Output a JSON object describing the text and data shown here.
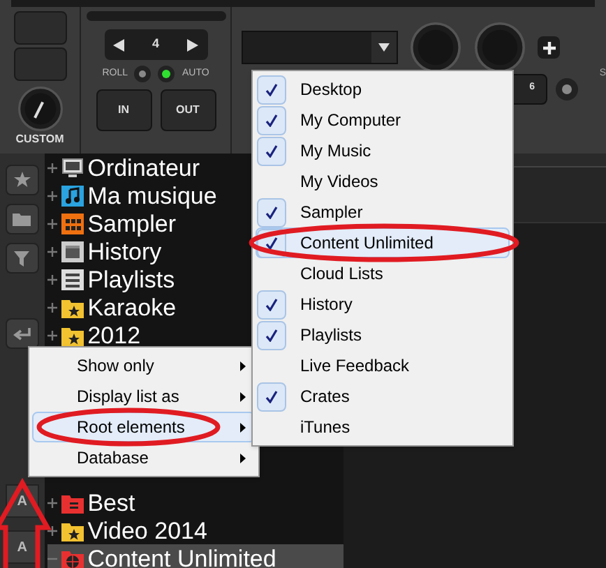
{
  "deck": {
    "loop_value": "4",
    "roll_label": "ROLL",
    "auto_label": "AUTO",
    "auto_on": true,
    "in_label": "IN",
    "out_label": "OUT",
    "knob_label": "CUSTOM",
    "pad_value": "6",
    "edge_label": "S"
  },
  "side_labels": [
    "A",
    "A"
  ],
  "tree": [
    {
      "label": "Ordinateur",
      "kind": "computer",
      "expanded": false,
      "selected": false
    },
    {
      "label": "Ma musique",
      "kind": "music",
      "expanded": false,
      "selected": false
    },
    {
      "label": "Sampler",
      "kind": "sampler",
      "expanded": false,
      "selected": false
    },
    {
      "label": "History",
      "kind": "history",
      "expanded": false,
      "selected": false
    },
    {
      "label": "Playlists",
      "kind": "playlists",
      "expanded": false,
      "selected": false
    },
    {
      "label": "Karaoke",
      "kind": "star-folder",
      "expanded": false,
      "selected": false
    },
    {
      "label": "2012",
      "kind": "star-folder",
      "expanded": false,
      "selected": false
    },
    {
      "kind": "hidden"
    },
    {
      "kind": "hidden"
    },
    {
      "kind": "hidden"
    },
    {
      "kind": "hidden"
    },
    {
      "kind": "hidden"
    },
    {
      "label": "Best",
      "kind": "list-folder",
      "expanded": false,
      "selected": false
    },
    {
      "label": "Video 2014",
      "kind": "star-folder",
      "expanded": false,
      "selected": false
    },
    {
      "label": "Content Unlimited",
      "kind": "globe-folder",
      "expanded": true,
      "selected": true
    }
  ],
  "context_menu": {
    "items": [
      {
        "label": "Show only",
        "selected": false
      },
      {
        "label": "Display list as",
        "selected": false
      },
      {
        "label": "Root elements",
        "selected": true
      },
      {
        "label": "Database",
        "selected": false
      }
    ]
  },
  "submenu": {
    "items": [
      {
        "label": "Desktop",
        "checked": true,
        "selected": false
      },
      {
        "label": "My Computer",
        "checked": true,
        "selected": false
      },
      {
        "label": "My Music",
        "checked": true,
        "selected": false
      },
      {
        "label": "My Videos",
        "checked": false,
        "selected": false
      },
      {
        "label": "Sampler",
        "checked": true,
        "selected": false
      },
      {
        "label": "Content Unlimited",
        "checked": true,
        "selected": true
      },
      {
        "label": "Cloud Lists",
        "checked": false,
        "selected": false
      },
      {
        "label": "History",
        "checked": true,
        "selected": false
      },
      {
        "label": "Playlists",
        "checked": true,
        "selected": false
      },
      {
        "label": "Live Feedback",
        "checked": false,
        "selected": false
      },
      {
        "label": "Crates",
        "checked": true,
        "selected": false
      },
      {
        "label": "iTunes",
        "checked": false,
        "selected": false
      }
    ]
  }
}
